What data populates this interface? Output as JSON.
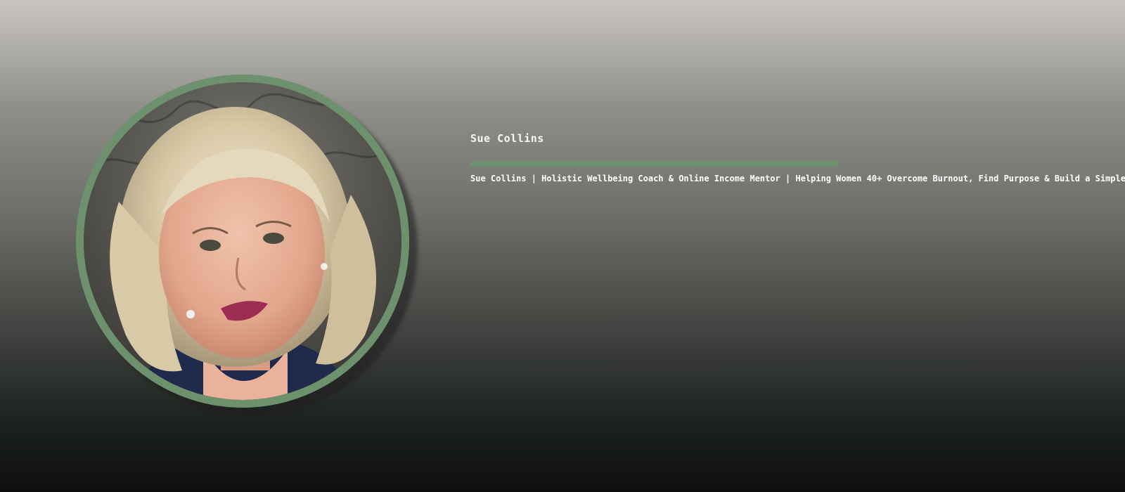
{
  "profile": {
    "name": "Sue Collins",
    "tagline": "Sue Collins | Holistic Wellbeing Coach & Online Income Mentor | Helping Women 40+ Overcome Burnout, Find Purpose & Build a Simple Online Business",
    "photo_icon": "portrait-photo"
  },
  "colors": {
    "accent": "#6d906d",
    "text": "#ffffff",
    "background_top": "#c9c6c1",
    "background_bottom": "#0d0f0d"
  }
}
